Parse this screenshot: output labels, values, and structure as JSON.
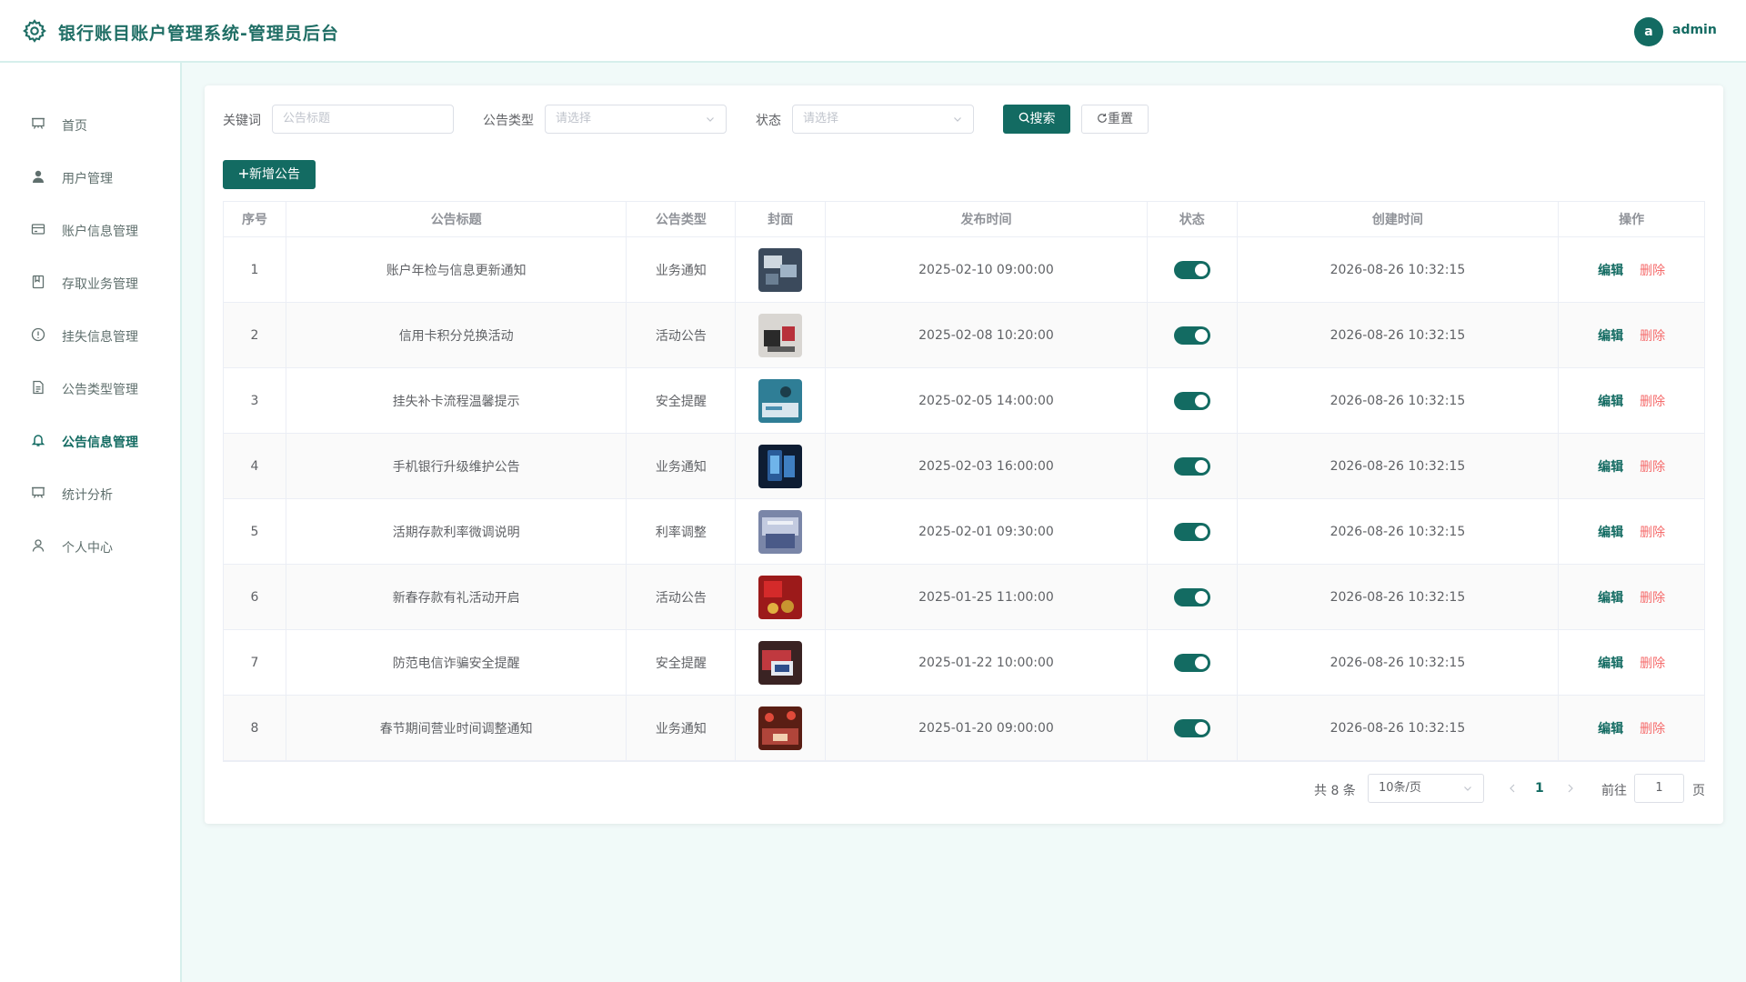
{
  "header": {
    "title": "银行账目账户管理系统-管理员后台",
    "avatar_letter": "a",
    "username": "admin"
  },
  "sidebar": {
    "items": [
      {
        "label": "首页",
        "icon": "presentation-icon"
      },
      {
        "label": "用户管理",
        "icon": "user-filled-icon"
      },
      {
        "label": "账户信息管理",
        "icon": "credit-card-icon"
      },
      {
        "label": "存取业务管理",
        "icon": "notebook-icon"
      },
      {
        "label": "挂失信息管理",
        "icon": "warning-circle-icon"
      },
      {
        "label": "公告类型管理",
        "icon": "document-icon"
      },
      {
        "label": "公告信息管理",
        "icon": "bell-icon",
        "active": true
      },
      {
        "label": "统计分析",
        "icon": "presentation-icon"
      },
      {
        "label": "个人中心",
        "icon": "user-icon"
      }
    ]
  },
  "filters": {
    "keyword_label": "关键词",
    "keyword_placeholder": "公告标题",
    "type_label": "公告类型",
    "type_placeholder": "请选择",
    "status_label": "状态",
    "status_placeholder": "请选择",
    "search_label": "搜索",
    "reset_label": "重置"
  },
  "toolbar": {
    "add_label": "新增公告"
  },
  "table": {
    "columns": [
      "序号",
      "公告标题",
      "公告类型",
      "封面",
      "发布时间",
      "状态",
      "创建时间",
      "操作"
    ],
    "edit_label": "编辑",
    "delete_label": "删除",
    "rows": [
      {
        "index": "1",
        "title": "账户年检与信息更新通知",
        "type": "业务通知",
        "publish_time": "2025-02-10 09:00:00",
        "status": true,
        "created": "2026-08-26 10:32:15"
      },
      {
        "index": "2",
        "title": "信用卡积分兑换活动",
        "type": "活动公告",
        "publish_time": "2025-02-08 10:20:00",
        "status": true,
        "created": "2026-08-26 10:32:15"
      },
      {
        "index": "3",
        "title": "挂失补卡流程温馨提示",
        "type": "安全提醒",
        "publish_time": "2025-02-05 14:00:00",
        "status": true,
        "created": "2026-08-26 10:32:15"
      },
      {
        "index": "4",
        "title": "手机银行升级维护公告",
        "type": "业务通知",
        "publish_time": "2025-02-03 16:00:00",
        "status": true,
        "created": "2026-08-26 10:32:15"
      },
      {
        "index": "5",
        "title": "活期存款利率微调说明",
        "type": "利率调整",
        "publish_time": "2025-02-01 09:30:00",
        "status": true,
        "created": "2026-08-26 10:32:15"
      },
      {
        "index": "6",
        "title": "新春存款有礼活动开启",
        "type": "活动公告",
        "publish_time": "2025-01-25 11:00:00",
        "status": true,
        "created": "2026-08-26 10:32:15"
      },
      {
        "index": "7",
        "title": "防范电信诈骗安全提醒",
        "type": "安全提醒",
        "publish_time": "2025-01-22 10:00:00",
        "status": true,
        "created": "2026-08-26 10:32:15"
      },
      {
        "index": "8",
        "title": "春节期间营业时间调整通知",
        "type": "业务通知",
        "publish_time": "2025-01-20 09:00:00",
        "status": true,
        "created": "2026-08-26 10:32:15"
      }
    ]
  },
  "pagination": {
    "total_text": "共 8 条",
    "page_size": "10条/页",
    "current_page": "1",
    "goto_label": "前往",
    "goto_value": "1",
    "page_suffix": "页"
  },
  "colors": {
    "primary": "#136b62",
    "danger": "#f56c6c",
    "background": "#f1faf9"
  }
}
